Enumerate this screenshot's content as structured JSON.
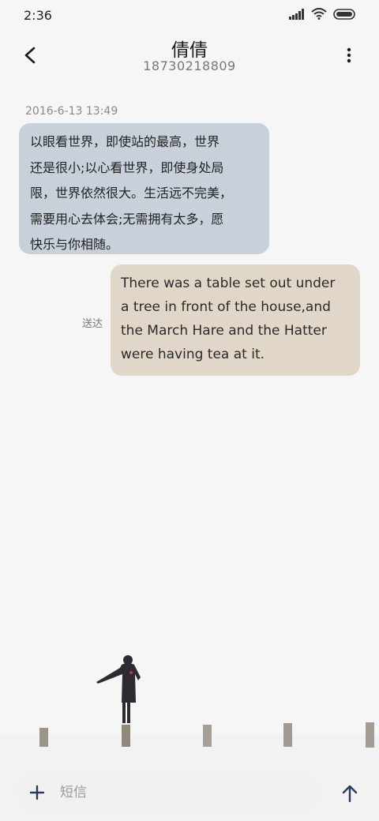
{
  "status_bar": {
    "time": "2:36",
    "icons": [
      "signal-icon",
      "wifi-icon",
      "battery-icon"
    ]
  },
  "header": {
    "back_icon": "back-arrow-icon",
    "contact_name": "倩倩",
    "phone_number": "18730218809",
    "more_icon": "more-vertical-icon"
  },
  "conversation": {
    "timestamp": "2016-6-13 13:49",
    "messages": [
      {
        "direction": "incoming",
        "lines": [
          "以眼看世界，即使站的最高，世界",
          "还是很小;以心看世界，即使身处局",
          "限，世界依然很大。生活远不完美，",
          "需要用心去体会;无需拥有太多，愿",
          "快乐与你相随。"
        ]
      },
      {
        "direction": "outgoing",
        "status": "送达",
        "lines": [
          "There was a table set out under",
          "a tree in front of the house,and",
          "the March Hare and the Hatter",
          "were having tea at it."
        ]
      }
    ]
  },
  "composer": {
    "add_icon": "plus-icon",
    "placeholder": "短信",
    "value": "",
    "send_icon": "send-arrow-icon"
  },
  "colors": {
    "incoming_bubble": "#c8d0da",
    "outgoing_bubble": "#e1d7c8",
    "background": "#f6f6f6"
  },
  "background_image": "snowy-field-with-person-icon"
}
